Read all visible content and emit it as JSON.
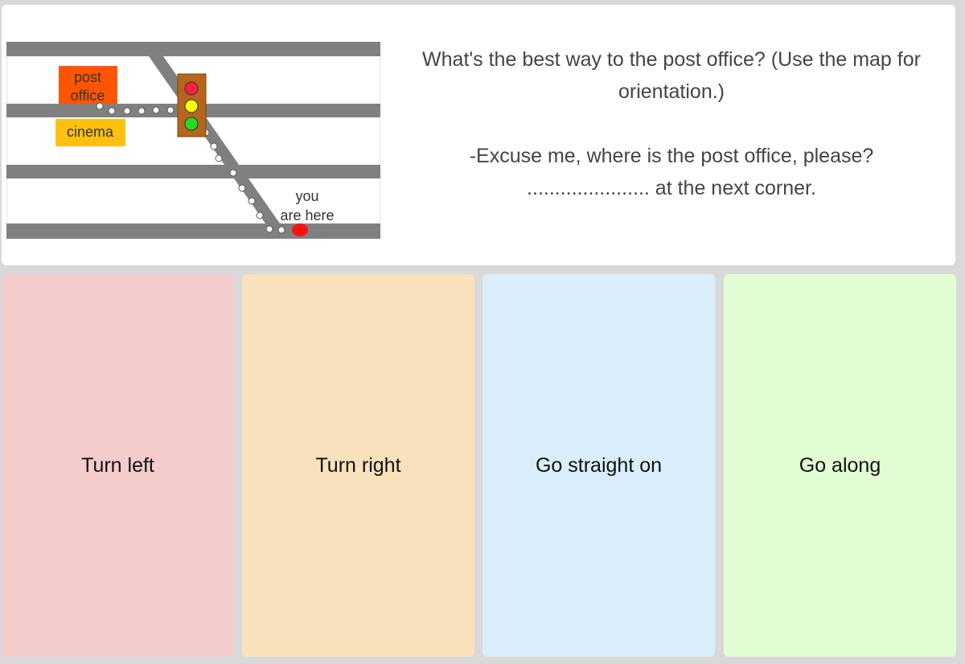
{
  "question": {
    "line1": "What's the best way to the post office? (Use the map for orientation.)",
    "line2": "-Excuse me, where is the post office, please?",
    "line3": "...................... at the next corner."
  },
  "map": {
    "post_office_line1": "post",
    "post_office_line2": "office",
    "cinema": "cinema",
    "you_are_here_line1": "you",
    "you_are_here_line2": "are here"
  },
  "answers": [
    {
      "label": "Turn left",
      "color": "#f4cccc"
    },
    {
      "label": "Turn right",
      "color": "#f9e2bb"
    },
    {
      "label": "Go straight on",
      "color": "#d9eefa"
    },
    {
      "label": "Go along",
      "color": "#e2fdd4"
    }
  ]
}
